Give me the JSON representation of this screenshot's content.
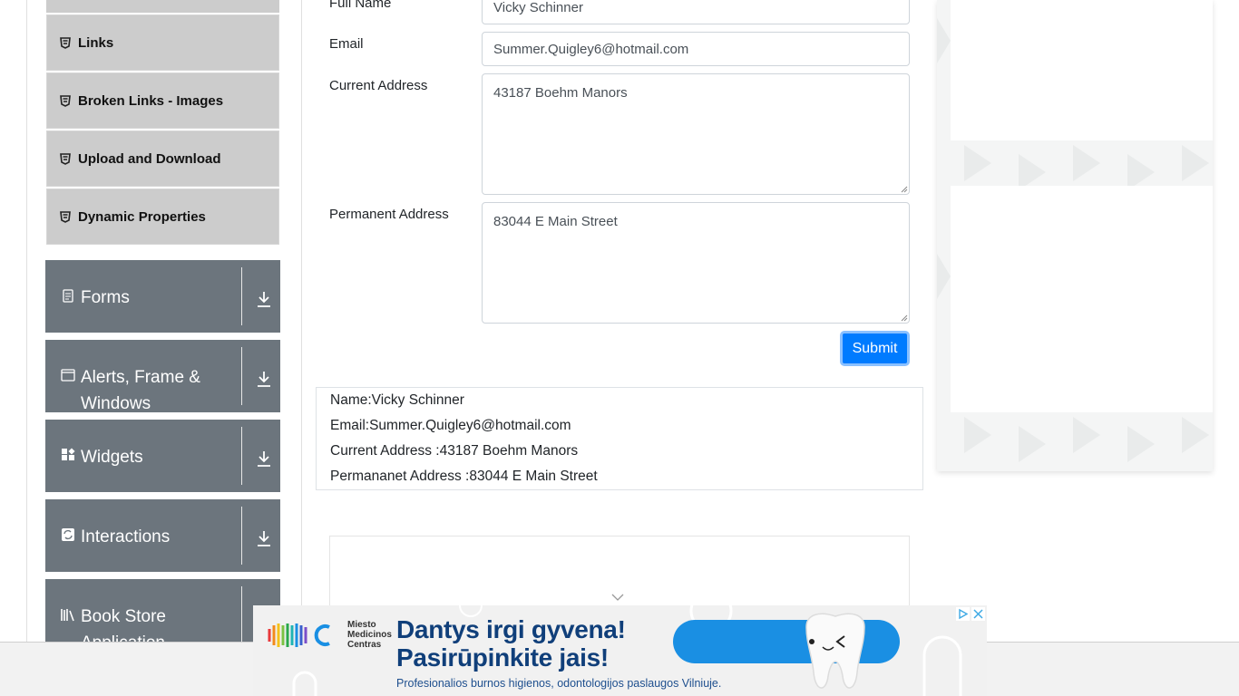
{
  "sidebar": {
    "sub_items": [
      {
        "label": "Links"
      },
      {
        "label": "Broken Links - Images"
      },
      {
        "label": "Upload and Download"
      },
      {
        "label": "Dynamic Properties"
      }
    ],
    "groups": [
      {
        "label": "Forms"
      },
      {
        "label": "Alerts, Frame & Windows"
      },
      {
        "label": "Widgets"
      },
      {
        "label": "Interactions"
      },
      {
        "label": "Book Store Application"
      }
    ]
  },
  "form": {
    "full_name_label": "Full Name",
    "full_name_value": "Vicky Schinner",
    "email_label": "Email",
    "email_value": "Summer.Quigley6@hotmail.com",
    "current_address_label": "Current Address",
    "current_address_value": "43187 Boehm Manors",
    "permanent_address_label": "Permanent Address",
    "permanent_address_value": "83044 E Main Street",
    "submit_label": "Submit"
  },
  "output": {
    "name": "Name:Vicky Schinner",
    "email": "Email:Summer.Quigley6@hotmail.com",
    "current_address": "Current Address :43187 Boehm Manors",
    "permanent_address": "Permananet Address :83044 E Main Street"
  },
  "ad": {
    "brand_line1": "Miesto",
    "brand_line2": "Medicinos",
    "brand_line3": "Centras",
    "headline1": "Dantys irgi gyvena!",
    "headline2": "Pasirūpinkite jais!",
    "subline": "Profesionalios burnos higienos, odontologijos paslaugos Vilniuje."
  },
  "colors": {
    "primary": "#007bff",
    "sidebar_group": "#6c757d",
    "sidebar_item": "#cccccc",
    "ad_blue": "#1a8fe3",
    "ad_text": "#103f7a"
  }
}
